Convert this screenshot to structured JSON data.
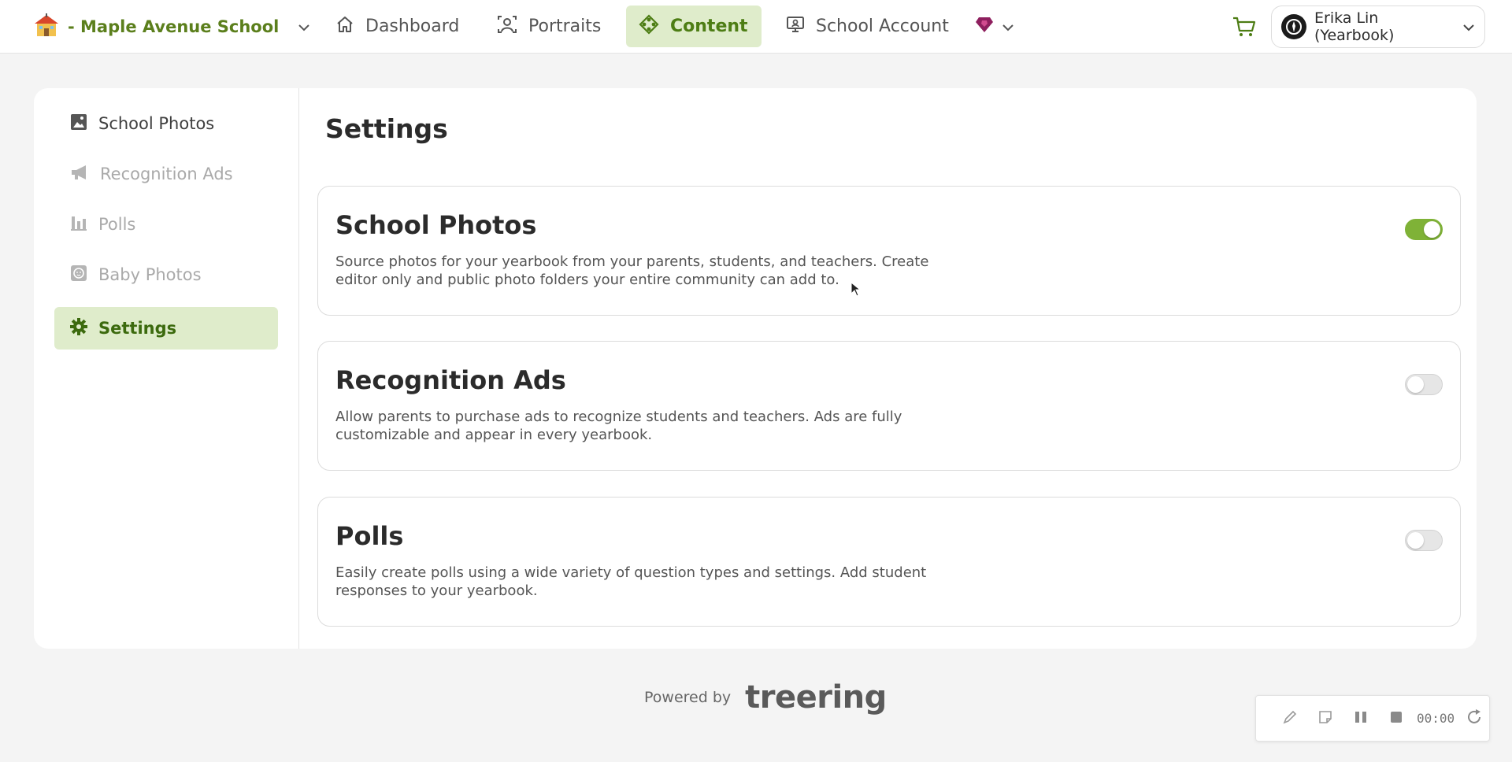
{
  "topbar": {
    "school_name": "- Maple Avenue School",
    "nav": {
      "dashboard": "Dashboard",
      "portraits": "Portraits",
      "content": "Content",
      "school_account": "School Account"
    },
    "user_name": "Erika Lin (Yearbook)"
  },
  "sidebar": {
    "items": [
      {
        "label": "School Photos",
        "icon": "photo-icon",
        "state": "enabled"
      },
      {
        "label": "Recognition Ads",
        "icon": "megaphone-icon",
        "state": "disabled"
      },
      {
        "label": "Polls",
        "icon": "bar-chart-icon",
        "state": "disabled"
      },
      {
        "label": "Baby Photos",
        "icon": "baby-icon",
        "state": "disabled"
      },
      {
        "label": "Settings",
        "icon": "gear-icon",
        "state": "active"
      }
    ]
  },
  "main": {
    "title": "Settings",
    "cards": [
      {
        "title": "School Photos",
        "description": "Source photos for your yearbook from your parents, students, and teachers. Create editor only and public photo folders your entire community can add to.",
        "enabled": true
      },
      {
        "title": "Recognition Ads",
        "description": "Allow parents to purchase ads to recognize students and teachers. Ads are fully customizable and appear in every yearbook.",
        "enabled": false
      },
      {
        "title": "Polls",
        "description": "Easily create polls using a wide variety of question types and settings. Add student responses to your yearbook.",
        "enabled": false
      }
    ]
  },
  "footer": {
    "powered_label": "Powered by",
    "brand": "treering"
  },
  "recorder": {
    "time": "00:00"
  },
  "colors": {
    "accent": "#5b7f1c",
    "active_bg": "#dfeccb",
    "toggle_on": "#7fb237",
    "premium": "#8e1f5e"
  }
}
